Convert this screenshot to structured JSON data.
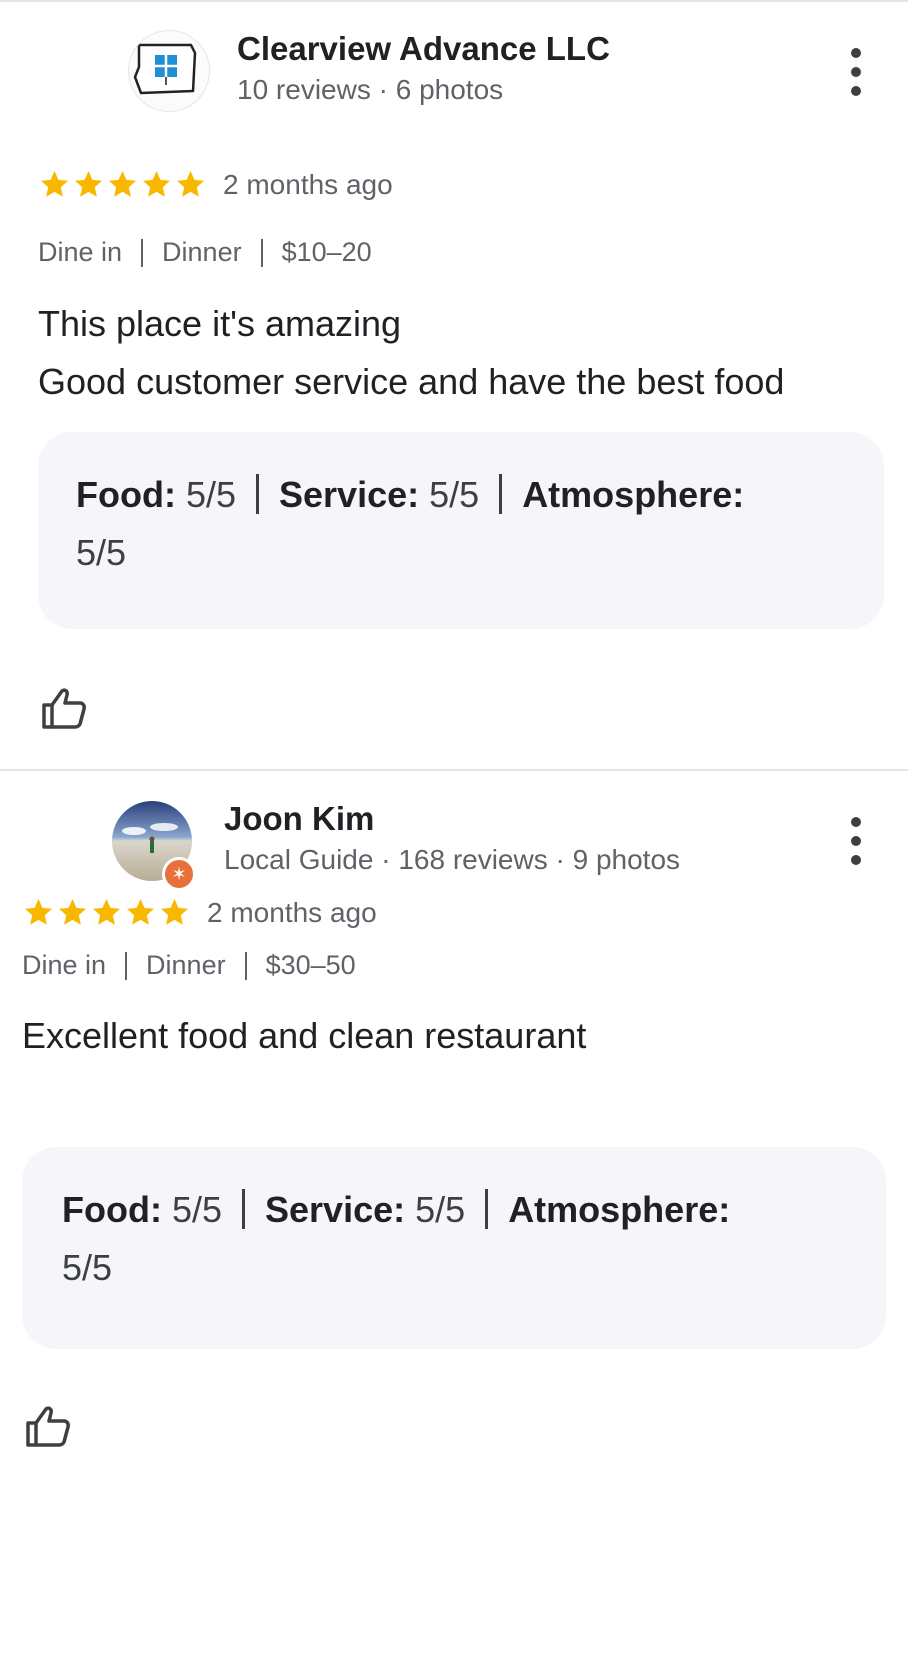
{
  "colors": {
    "star": "#f9b800",
    "text_primary": "#202124",
    "text_secondary": "#5f6368",
    "box_bg": "#f6f6fa",
    "guide_badge": "#e8703a"
  },
  "reviews": [
    {
      "author": {
        "name": "Clearview Advance LLC",
        "meta": "10 reviews · 6 photos",
        "avatar_icon": "oregon-window-logo"
      },
      "rating": 5,
      "time_ago": "2 months ago",
      "tags": [
        "Dine in",
        "Dinner",
        "$10–20"
      ],
      "text_lines": [
        "This place it's amazing",
        "Good customer service and have the best food"
      ],
      "sub_ratings": {
        "food_label": "Food:",
        "food_value": "5/5",
        "service_label": "Service:",
        "service_value": "5/5",
        "atmosphere_label": "Atmosphere:",
        "atmosphere_value": "5/5"
      },
      "like_icon": "thumbs-up-icon",
      "more_icon": "more-vert-icon"
    },
    {
      "author": {
        "name": "Joon Kim",
        "meta": "Local Guide · 168 reviews · 9 photos",
        "avatar_icon": "landscape-photo",
        "badge_icon": "local-guide-star-icon"
      },
      "rating": 5,
      "time_ago": "2 months ago",
      "tags": [
        "Dine in",
        "Dinner",
        "$30–50"
      ],
      "text_lines": [
        "Excellent food and clean restaurant"
      ],
      "sub_ratings": {
        "food_label": "Food:",
        "food_value": "5/5",
        "service_label": "Service:",
        "service_value": "5/5",
        "atmosphere_label": "Atmosphere:",
        "atmosphere_value": "5/5"
      },
      "like_icon": "thumbs-up-icon",
      "more_icon": "more-vert-icon"
    }
  ]
}
